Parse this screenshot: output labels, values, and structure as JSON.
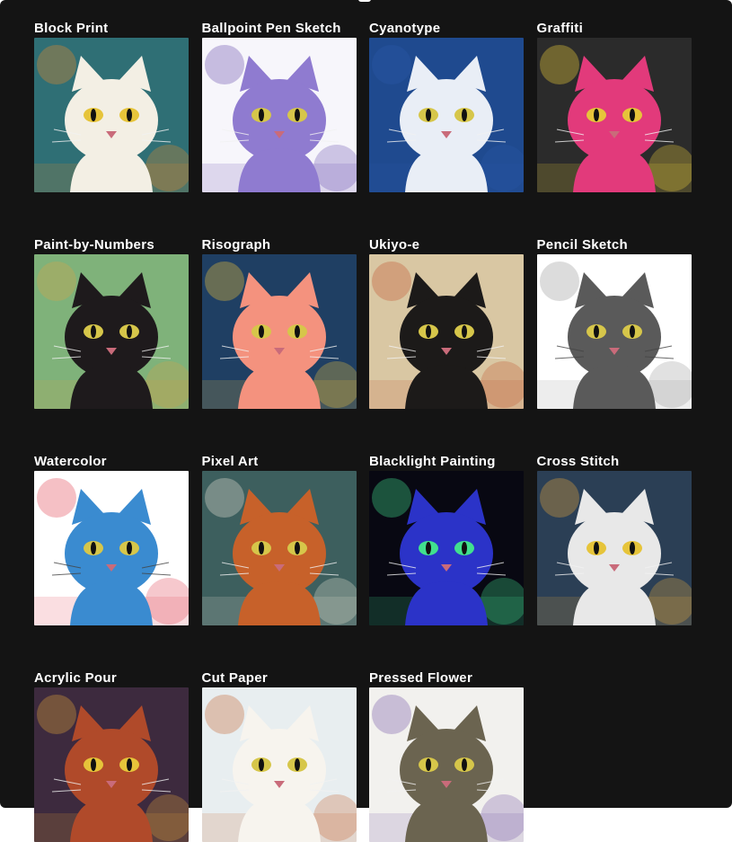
{
  "gallery": {
    "items": [
      {
        "name": "block-print",
        "label": "Block Print",
        "bg": "#2f6f75",
        "accent": "#e98a2c",
        "cat": "#f3efe4"
      },
      {
        "name": "ballpoint-pen-sketch",
        "label": "Ballpoint Pen Sketch",
        "bg": "#f7f6fb",
        "accent": "#6b4fb0",
        "cat": "#8f7bd0"
      },
      {
        "name": "cyanotype",
        "label": "Cyanotype",
        "bg": "#1f4a8f",
        "accent": "#2a5aa8",
        "cat": "#e9eef6"
      },
      {
        "name": "graffiti",
        "label": "Graffiti",
        "bg": "#2b2b2b",
        "accent": "#f0d23a",
        "cat": "#e23a7b"
      },
      {
        "name": "paint-by-numbers",
        "label": "Paint-by-Numbers",
        "bg": "#7fb27a",
        "accent": "#d4a34a",
        "cat": "#1e1a1c"
      },
      {
        "name": "risograph",
        "label": "Risograph",
        "bg": "#1f3f63",
        "accent": "#f2c23a",
        "cat": "#f4927e"
      },
      {
        "name": "ukiyo-e",
        "label": "Ukiyo-e",
        "bg": "#d9c7a3",
        "accent": "#c25a35",
        "cat": "#1c1a19"
      },
      {
        "name": "pencil-sketch",
        "label": "Pencil Sketch",
        "bg": "#ffffff",
        "accent": "#9a9a9a",
        "cat": "#5a5a5a"
      },
      {
        "name": "watercolor",
        "label": "Watercolor",
        "bg": "#ffffff",
        "accent": "#e24a5a",
        "cat": "#3a8bd0"
      },
      {
        "name": "pixel-art",
        "label": "Pixel Art",
        "bg": "#3d5f5e",
        "accent": "#e9e3d4",
        "cat": "#c7612a"
      },
      {
        "name": "blacklight-painting",
        "label": "Blacklight Painting",
        "bg": "#080812",
        "accent": "#41e08e",
        "cat": "#2b33c8"
      },
      {
        "name": "cross-stitch",
        "label": "Cross Stitch",
        "bg": "#2b3f55",
        "accent": "#e1a43c",
        "cat": "#e8e8e8"
      },
      {
        "name": "acrylic-pour",
        "label": "Acrylic Pour",
        "bg": "#3d2a3e",
        "accent": "#e0a33a",
        "cat": "#b04a2a"
      },
      {
        "name": "cut-paper",
        "label": "Cut Paper",
        "bg": "#e8eef0",
        "accent": "#c76a3a",
        "cat": "#f7f4ee"
      },
      {
        "name": "pressed-flower",
        "label": "Pressed Flower",
        "bg": "#f2f1ee",
        "accent": "#7a5ca8",
        "cat": "#6b6450"
      }
    ]
  }
}
